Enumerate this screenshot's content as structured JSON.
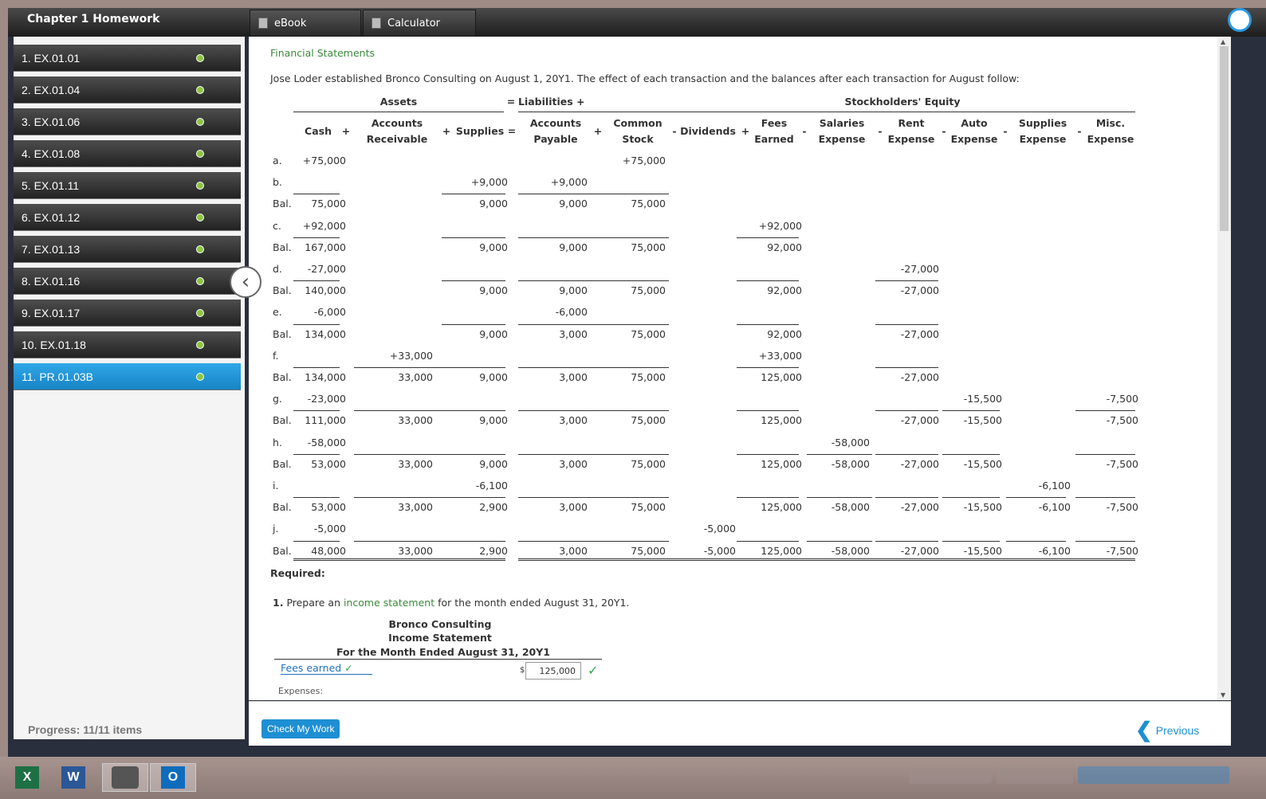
{
  "header": {
    "chapter_title": "Chapter 1 Homework",
    "tools": [
      {
        "label": "eBook",
        "icon": "book-icon"
      },
      {
        "label": "Calculator",
        "icon": "calculator-icon"
      }
    ]
  },
  "sidebar": {
    "items": [
      {
        "label": "1. EX.01.01",
        "done": true
      },
      {
        "label": "2. EX.01.04",
        "done": true
      },
      {
        "label": "3. EX.01.06",
        "done": true
      },
      {
        "label": "4. EX.01.08",
        "done": true
      },
      {
        "label": "5. EX.01.11",
        "done": true
      },
      {
        "label": "6. EX.01.12",
        "done": true
      },
      {
        "label": "7. EX.01.13",
        "done": true
      },
      {
        "label": "8. EX.01.16",
        "done": true
      },
      {
        "label": "9. EX.01.17",
        "done": true
      },
      {
        "label": "10. EX.01.18",
        "done": true
      },
      {
        "label": "11. PR.01.03B",
        "done": true,
        "active": true
      }
    ],
    "progress": "Progress: 11/11 items"
  },
  "problem": {
    "title": "Financial Statements",
    "intro": "Jose Loder established Bronco Consulting on August 1, 20Y1. The effect of each transaction and the balances after each transaction for August follow:",
    "groups": {
      "assets": "Assets",
      "eq1": "=",
      "liabilities": "Liabilities +",
      "equity": "Stockholders' Equity"
    },
    "columns": [
      {
        "l1": "Cash",
        "l2": ""
      },
      {
        "l1": "Accounts",
        "l2": "Receivable"
      },
      {
        "l1": "Supplies",
        "l2": ""
      },
      {
        "l1": "Accounts",
        "l2": "Payable"
      },
      {
        "l1": "Common",
        "l2": "Stock"
      },
      {
        "l1": "Dividends",
        "l2": ""
      },
      {
        "l1": "Fees",
        "l2": "Earned"
      },
      {
        "l1": "Salaries",
        "l2": "Expense"
      },
      {
        "l1": "Rent",
        "l2": "Expense"
      },
      {
        "l1": "Auto",
        "l2": "Expense"
      },
      {
        "l1": "Supplies",
        "l2": "Expense"
      },
      {
        "l1": "Misc.",
        "l2": "Expense"
      }
    ],
    "operators": [
      "+",
      "+",
      "=",
      "+",
      "-",
      "+",
      "-",
      "-",
      "-",
      "-",
      "-"
    ],
    "rows": [
      {
        "label": "a.",
        "cells": [
          "+75,000",
          "",
          "",
          "",
          "+75,000",
          "",
          "",
          "",
          "",
          "",
          "",
          ""
        ]
      },
      {
        "label": "b.",
        "cells": [
          "",
          "",
          "+9,000",
          "+9,000",
          "",
          "",
          "",
          "",
          "",
          "",
          "",
          ""
        ]
      },
      {
        "label": "Bal.",
        "cells": [
          "75,000",
          "",
          "9,000",
          "9,000",
          "75,000",
          "",
          "",
          "",
          "",
          "",
          "",
          ""
        ]
      },
      {
        "label": "c.",
        "cells": [
          "+92,000",
          "",
          "",
          "",
          "",
          "",
          "+92,000",
          "",
          "",
          "",
          "",
          ""
        ]
      },
      {
        "label": "Bal.",
        "cells": [
          "167,000",
          "",
          "9,000",
          "9,000",
          "75,000",
          "",
          "92,000",
          "",
          "",
          "",
          "",
          ""
        ]
      },
      {
        "label": "d.",
        "cells": [
          "-27,000",
          "",
          "",
          "",
          "",
          "",
          "",
          "",
          "-27,000",
          "",
          "",
          ""
        ]
      },
      {
        "label": "Bal.",
        "cells": [
          "140,000",
          "",
          "9,000",
          "9,000",
          "75,000",
          "",
          "92,000",
          "",
          "-27,000",
          "",
          "",
          ""
        ]
      },
      {
        "label": "e.",
        "cells": [
          "-6,000",
          "",
          "",
          "-6,000",
          "",
          "",
          "",
          "",
          "",
          "",
          "",
          ""
        ]
      },
      {
        "label": "Bal.",
        "cells": [
          "134,000",
          "",
          "9,000",
          "3,000",
          "75,000",
          "",
          "92,000",
          "",
          "-27,000",
          "",
          "",
          ""
        ]
      },
      {
        "label": "f.",
        "cells": [
          "",
          "+33,000",
          "",
          "",
          "",
          "",
          "+33,000",
          "",
          "",
          "",
          "",
          ""
        ]
      },
      {
        "label": "Bal.",
        "cells": [
          "134,000",
          "33,000",
          "9,000",
          "3,000",
          "75,000",
          "",
          "125,000",
          "",
          "-27,000",
          "",
          "",
          ""
        ]
      },
      {
        "label": "g.",
        "cells": [
          "-23,000",
          "",
          "",
          "",
          "",
          "",
          "",
          "",
          "",
          "-15,500",
          "",
          "-7,500"
        ]
      },
      {
        "label": "Bal.",
        "cells": [
          "111,000",
          "33,000",
          "9,000",
          "3,000",
          "75,000",
          "",
          "125,000",
          "",
          "-27,000",
          "-15,500",
          "",
          "-7,500"
        ]
      },
      {
        "label": "h.",
        "cells": [
          "-58,000",
          "",
          "",
          "",
          "",
          "",
          "",
          "-58,000",
          "",
          "",
          "",
          ""
        ]
      },
      {
        "label": "Bal.",
        "cells": [
          "53,000",
          "33,000",
          "9,000",
          "3,000",
          "75,000",
          "",
          "125,000",
          "-58,000",
          "-27,000",
          "-15,500",
          "",
          "-7,500"
        ]
      },
      {
        "label": "i.",
        "cells": [
          "",
          "",
          "-6,100",
          "",
          "",
          "",
          "",
          "",
          "",
          "",
          "-6,100",
          ""
        ]
      },
      {
        "label": "Bal.",
        "cells": [
          "53,000",
          "33,000",
          "2,900",
          "3,000",
          "75,000",
          "",
          "125,000",
          "-58,000",
          "-27,000",
          "-15,500",
          "-6,100",
          "-7,500"
        ]
      },
      {
        "label": "j.",
        "cells": [
          "-5,000",
          "",
          "",
          "",
          "",
          "-5,000",
          "",
          "",
          "",
          "",
          "",
          ""
        ]
      },
      {
        "label": "Bal.",
        "cells": [
          "48,000",
          "33,000",
          "2,900",
          "3,000",
          "75,000",
          "-5,000",
          "125,000",
          "-58,000",
          "-27,000",
          "-15,500",
          "-6,100",
          "-7,500"
        ]
      }
    ],
    "required_label": "Required:",
    "question_num": "1.",
    "question_pre": "Prepare an",
    "question_link": "income statement",
    "question_post": "for the month ended August 31, 20Y1.",
    "statement": {
      "company": "Bronco Consulting",
      "name": "Income Statement",
      "period": "For the Month Ended August 31, 20Y1",
      "fees_label": "Fees earned",
      "dollar": "$",
      "fees_value": "125,000",
      "expenses_label": "Expenses:"
    }
  },
  "footer": {
    "check_label": "Check My Work",
    "prev_label": "Previous"
  },
  "taskbar": {
    "apps": [
      {
        "letter": "X",
        "color": "#1d7044"
      },
      {
        "letter": "W",
        "color": "#2b5797"
      },
      {
        "letter": "",
        "color": "#555555"
      },
      {
        "letter": "O",
        "color": "#0f6cbd"
      }
    ]
  }
}
